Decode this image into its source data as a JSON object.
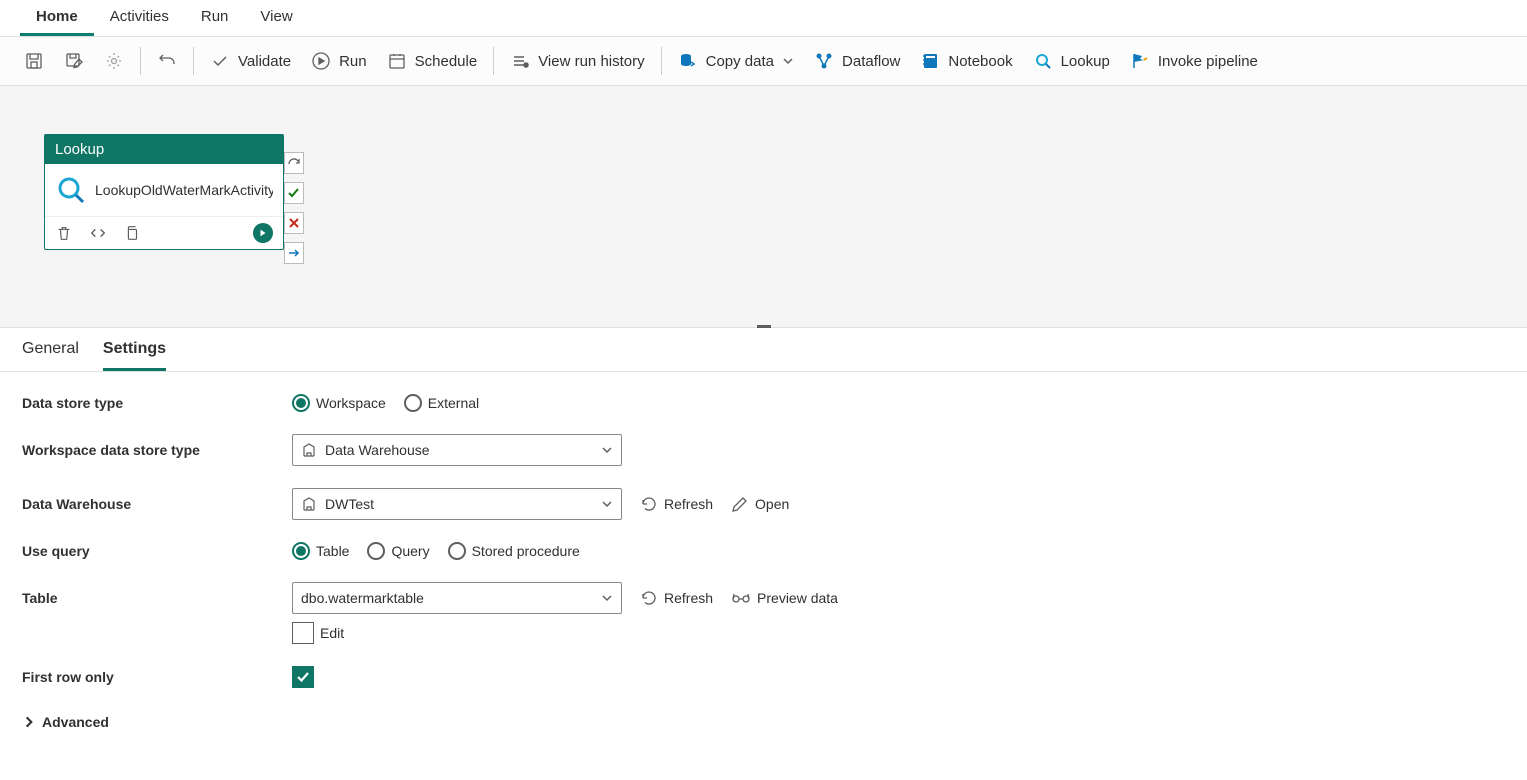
{
  "topTabs": {
    "home": "Home",
    "activities": "Activities",
    "run": "Run",
    "view": "View"
  },
  "toolbar": {
    "validate": "Validate",
    "run": "Run",
    "schedule": "Schedule",
    "viewRunHistory": "View run history",
    "copyData": "Copy data",
    "dataflow": "Dataflow",
    "notebook": "Notebook",
    "lookup": "Lookup",
    "invokePipeline": "Invoke pipeline"
  },
  "canvas": {
    "nodeType": "Lookup",
    "nodeName": "LookupOldWaterMarkActivity"
  },
  "panelTabs": {
    "general": "General",
    "settings": "Settings"
  },
  "form": {
    "dataStoreTypeLabel": "Data store type",
    "workspaceOpt": "Workspace",
    "externalOpt": "External",
    "workspaceDataStoreTypeLabel": "Workspace data store type",
    "dataWarehouseOpt": "Data Warehouse",
    "dataWarehouseLabel": "Data Warehouse",
    "dataWarehouseValue": "DWTest",
    "refresh": "Refresh",
    "open": "Open",
    "useQueryLabel": "Use query",
    "tableOpt": "Table",
    "queryOpt": "Query",
    "storedProcedureOpt": "Stored procedure",
    "tableLabel": "Table",
    "tableValue": "dbo.watermarktable",
    "previewData": "Preview data",
    "editLabel": "Edit",
    "firstRowOnlyLabel": "First row only",
    "advancedLabel": "Advanced"
  }
}
